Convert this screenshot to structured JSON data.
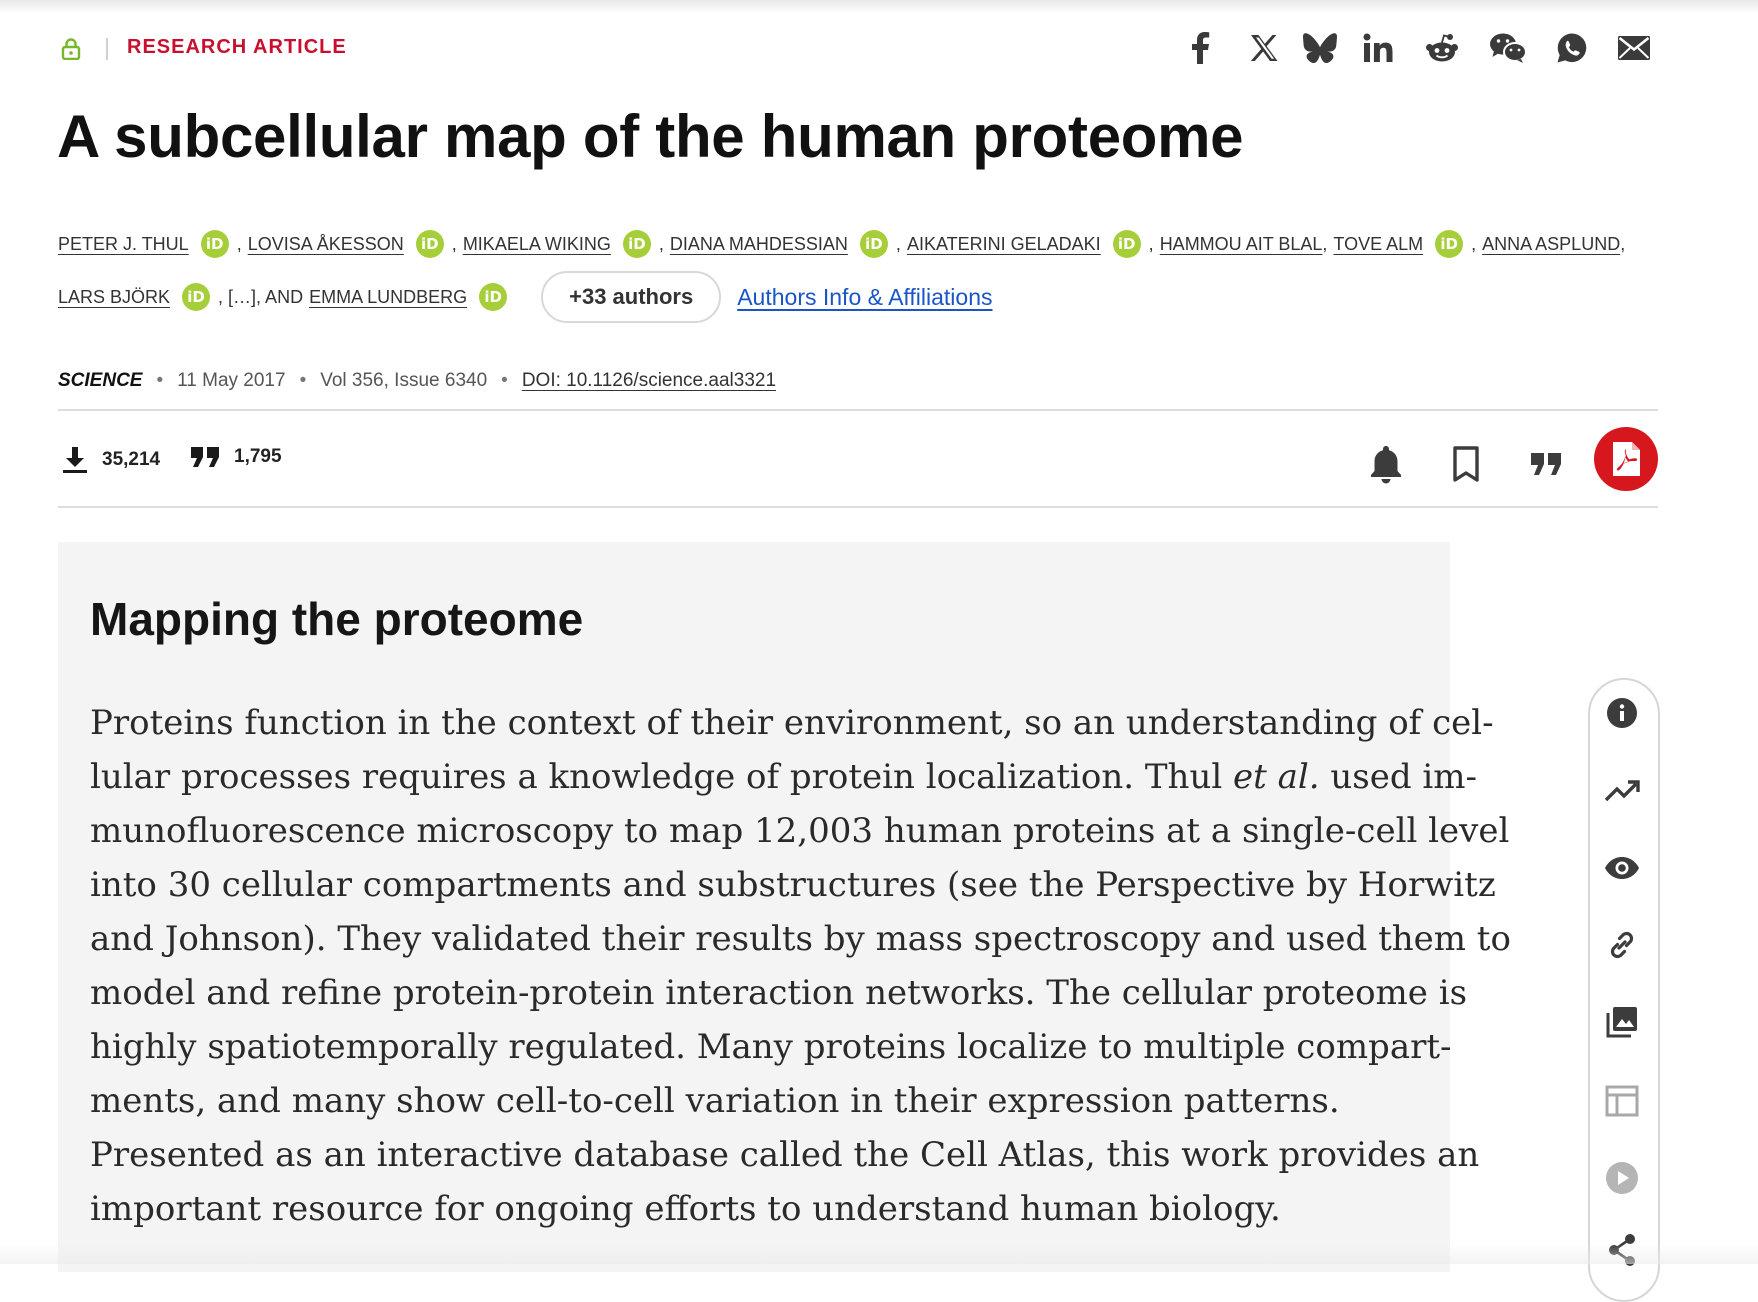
{
  "header": {
    "article_type": "RESEARCH ARTICLE",
    "share_icons": [
      "facebook-icon",
      "x-icon",
      "bluesky-icon",
      "linkedin-icon",
      "reddit-icon",
      "wechat-icon",
      "whatsapp-icon",
      "email-icon"
    ]
  },
  "article": {
    "title": "A subcellular map of the human proteome"
  },
  "authors": {
    "row1": [
      {
        "name": "PETER J. THUL",
        "orcid": true,
        "sep": ","
      },
      {
        "name": "LOVISA ÅKESSON",
        "orcid": true,
        "sep": ","
      },
      {
        "name": "MIKAELA WIKING",
        "orcid": true,
        "sep": ","
      },
      {
        "name": "DIANA MAHDESSIAN",
        "orcid": true,
        "sep": ","
      },
      {
        "name": "AIKATERINI GELADAKI",
        "orcid": true,
        "sep": ","
      },
      {
        "name": "HAMMOU AIT BLAL",
        "orcid": false,
        "sep": ","
      },
      {
        "name": "TOVE ALM",
        "orcid": true,
        "sep": ","
      },
      {
        "name": "ANNA ASPLUND",
        "orcid": false,
        "sep": ","
      }
    ],
    "row2_first": "LARS BJÖRK",
    "ellipsis": ", […], AND",
    "last": "EMMA LUNDBERG",
    "orcid_label": "iD",
    "more_button": "+33 authors",
    "affiliations_link": "Authors Info & Affiliations"
  },
  "meta": {
    "journal": "SCIENCE",
    "date": "11 May 2017",
    "volume": "Vol 356, Issue 6340",
    "doi": "DOI: 10.1126/science.aal3321"
  },
  "metrics": {
    "downloads": "35,214",
    "citations": "1,795"
  },
  "abstract": {
    "heading": "Mapping the proteome",
    "lines": [
      "Proteins function in the context of their environment, so an understanding of cel-",
      "lular processes requires a knowledge of protein localization. Thul ",
      "munofluorescence microscopy to map 12,003 human proteins at a single-cell level",
      "into 30 cellular compartments and substructures (see the Perspective by Horwitz",
      "and Johnson). They validated their results by mass spectroscopy and used them to",
      "model and refine protein-protein interaction networks. The cellular proteome is",
      "highly spatiotemporally regulated. Many proteins localize to multiple compart-",
      "ments, and many show cell-to-cell variation in their expression patterns.",
      "Presented as an interactive database called the Cell Atlas, this work provides an",
      "important resource for ongoing efforts to understand human biology."
    ],
    "line2_italic": "et al.",
    "line2_tail": " used im-"
  },
  "side_rail": [
    "info-icon",
    "trending-icon",
    "eye-icon",
    "link-icon",
    "image-icon",
    "table-icon",
    "play-icon",
    "share-icon"
  ],
  "colors": {
    "accent_red": "#c8102e",
    "orcid_green": "#a6ce39",
    "link_blue": "#1a55c8",
    "panel_bg": "#f4f4f4"
  }
}
